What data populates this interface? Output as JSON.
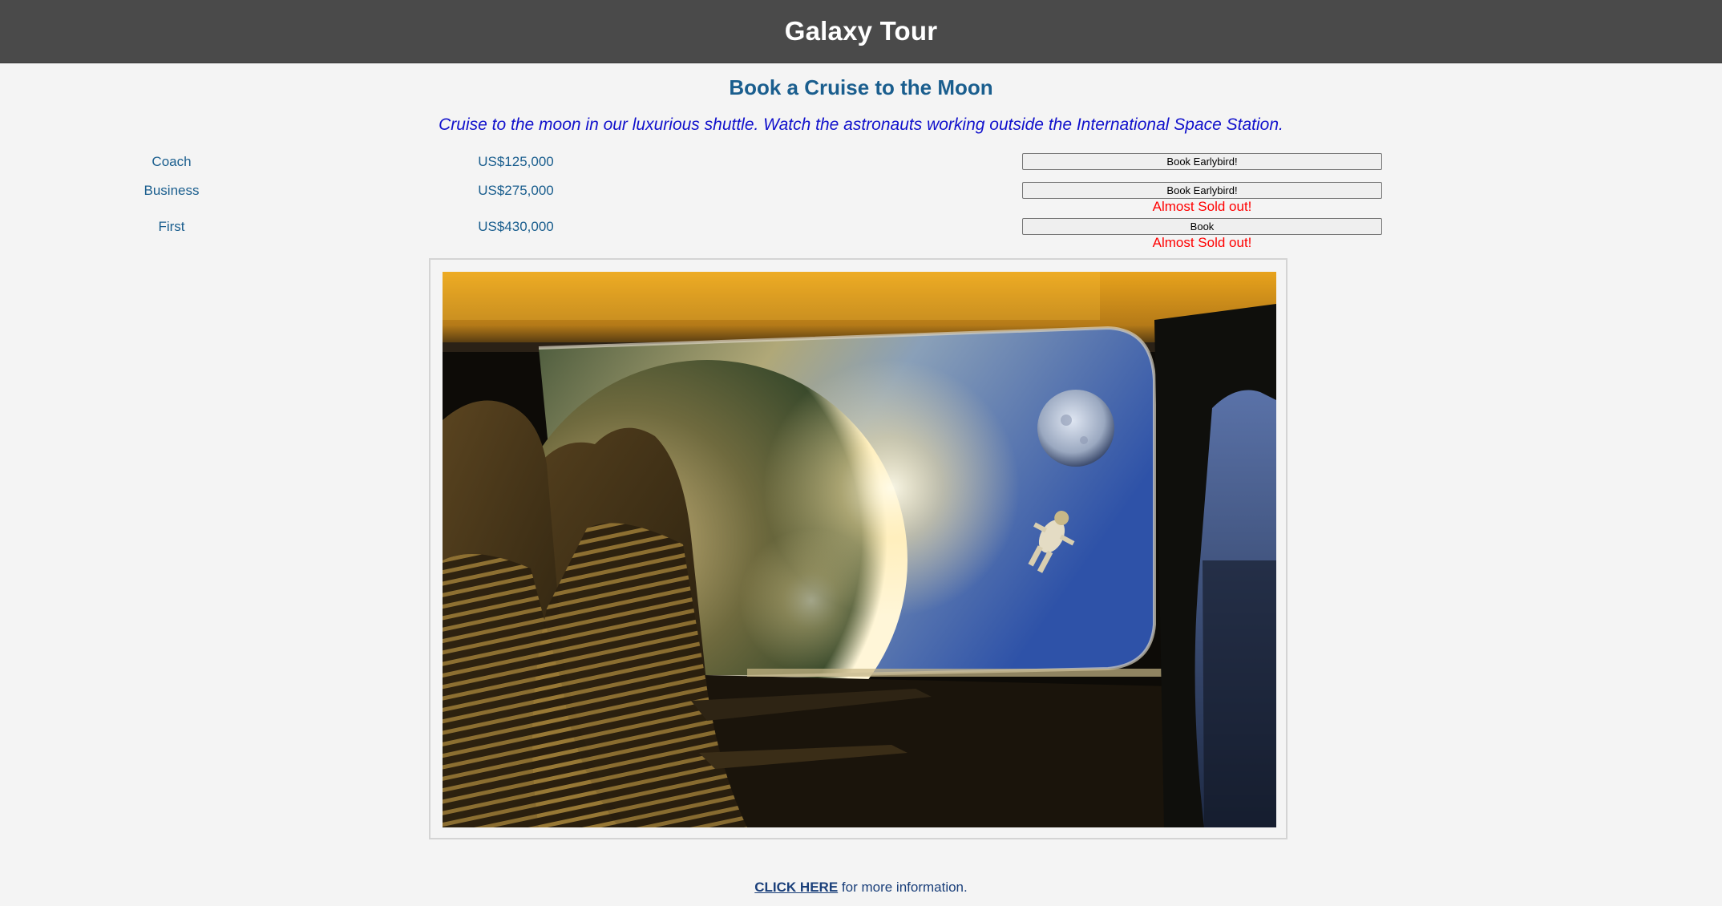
{
  "header": {
    "title": "Galaxy Tour"
  },
  "main": {
    "heading": "Book a Cruise to the Moon",
    "tagline": "Cruise to the moon in our luxurious shuttle. Watch the astronauts working outside the International Space Station."
  },
  "fares": [
    {
      "class": "Coach",
      "price": "US$125,000",
      "button": "Book Earlybird!",
      "note": ""
    },
    {
      "class": "Business",
      "price": "US$275,000",
      "button": "Book Earlybird!",
      "note": "Almost Sold out!"
    },
    {
      "class": "First",
      "price": "US$430,000",
      "button": "Book",
      "note": "Almost Sold out!"
    }
  ],
  "footer": {
    "link_text": "CLICK HERE",
    "suffix_text": " for more information."
  },
  "colors": {
    "header_bg": "#4a4a4a",
    "heading": "#1a5e8e",
    "tagline": "#1111cc",
    "sold_out": "#ff0000",
    "page_bg": "#f4f4f4"
  }
}
